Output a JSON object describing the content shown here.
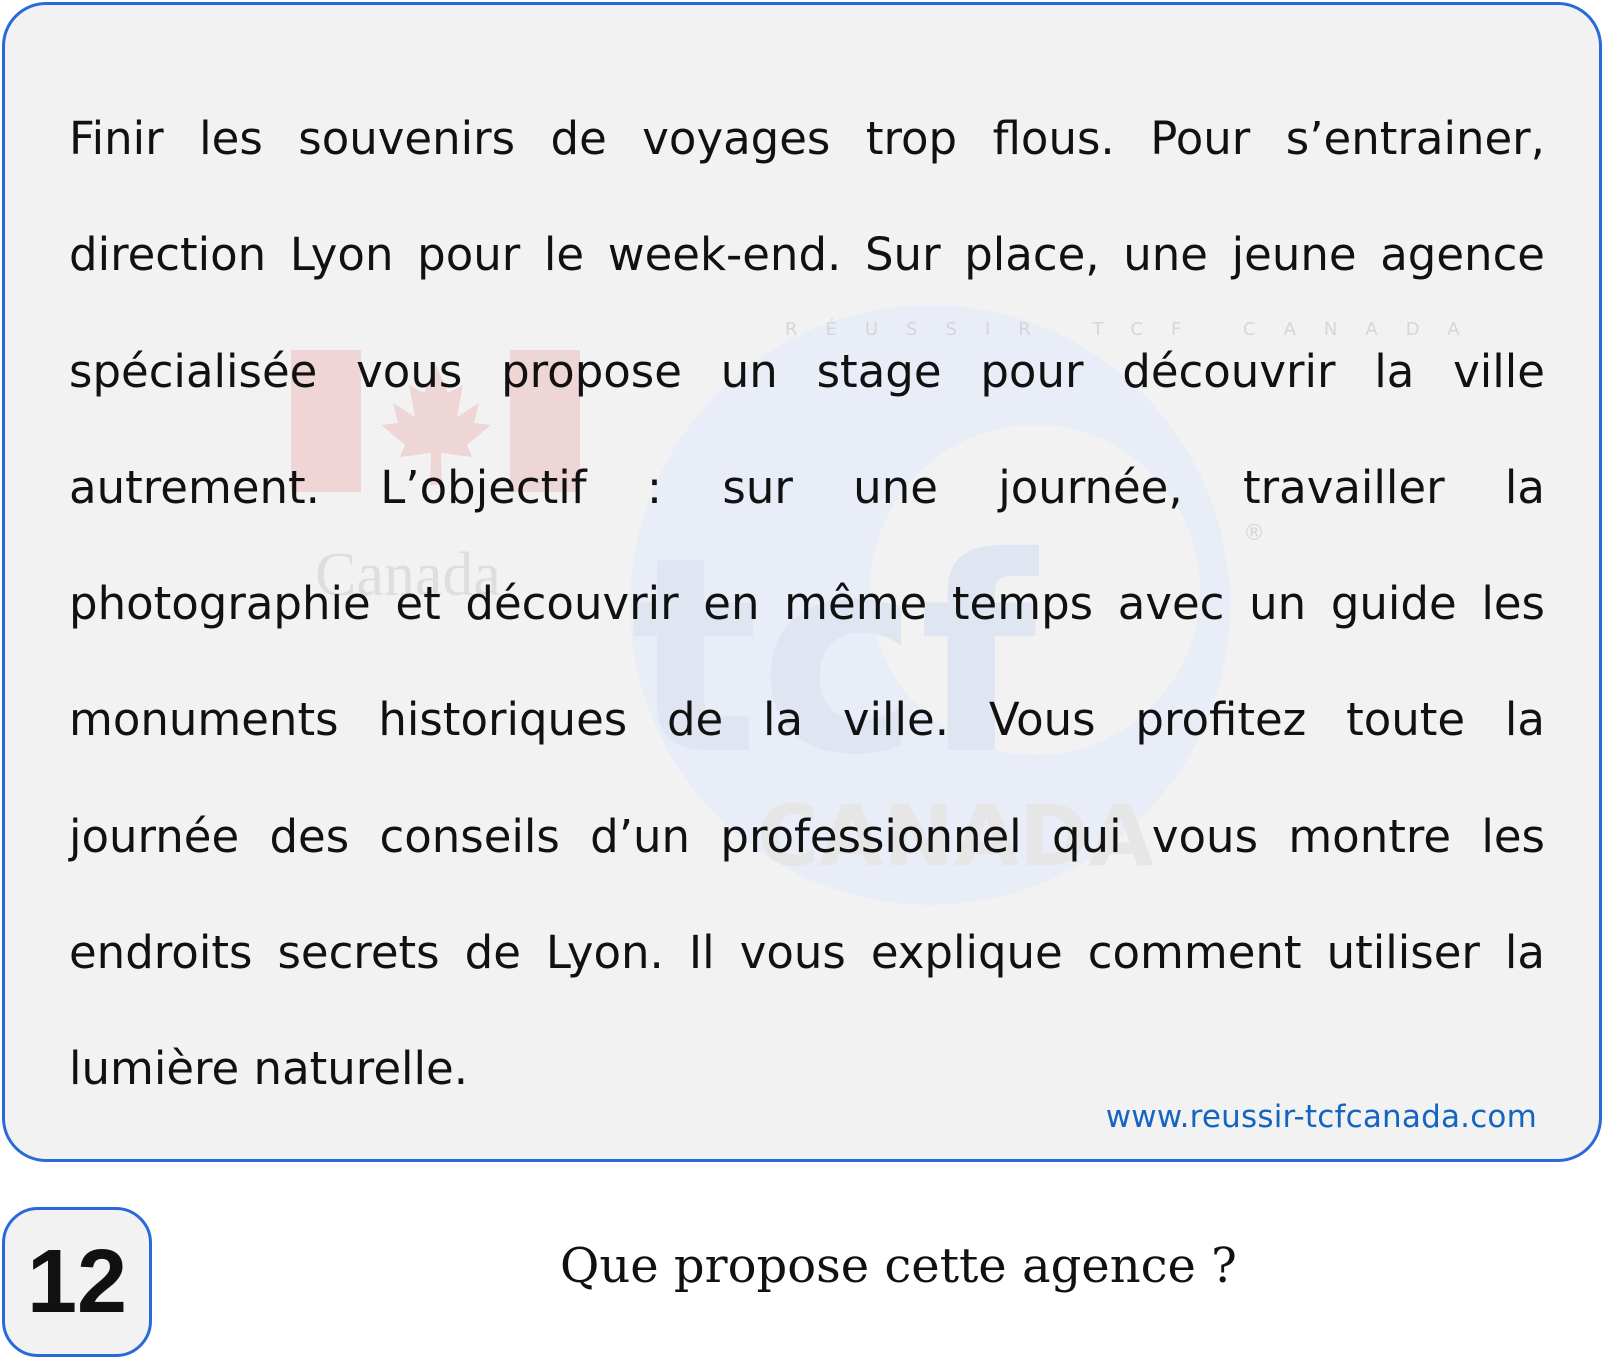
{
  "passage": {
    "lines": [
      "Finir les souvenirs de voyages trop flous. Pour s’entrainer,",
      "direction Lyon pour le week-end. Sur place, une jeune agence",
      "spécialisée vous propose un stage pour découvrir la ville",
      "autrement. L’objectif : sur une journée, travailler la",
      "photographie et découvrir en même temps avec un guide les",
      "monuments historiques de la ville. Vous profitez toute la",
      "journée des conseils d’un professionnel qui vous montre les",
      "endroits secrets de Lyon. Il vous explique comment utiliser la",
      "lumière naturelle."
    ]
  },
  "watermark": {
    "brand_word": "tcf",
    "brand_sub": "CANADA",
    "canada_word": "Canada",
    "ring_text": "RÉUSSIR TCF CANADA",
    "registered": "®"
  },
  "footer": {
    "url": "www.reussir-tcfcanada.com"
  },
  "question": {
    "number": "12",
    "text": "Que propose cette agence ?"
  },
  "colors": {
    "border": "#2a6ad8",
    "url": "#1565c0",
    "card_bg": "#f2f2f2",
    "text": "#111111"
  }
}
